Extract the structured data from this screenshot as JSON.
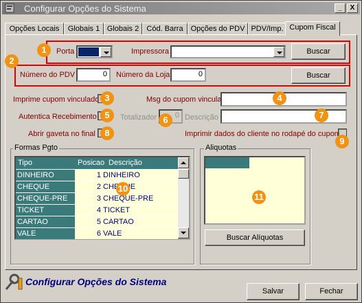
{
  "window": {
    "title": "Configurar Opções do Sistema",
    "minimize": "_",
    "close": "X"
  },
  "tabs": [
    {
      "label": "Opções Locais"
    },
    {
      "label": "Globais 1"
    },
    {
      "label": "Globais 2"
    },
    {
      "label": "Cód. Barra"
    },
    {
      "label": "Opções do PDV"
    },
    {
      "label": "PDV/Imp."
    },
    {
      "label": "Cupom Fiscal"
    }
  ],
  "printer": {
    "port_label": "Porta",
    "port_value": "",
    "printer_label": "Impressora",
    "printer_value": "",
    "search_label": "Buscar"
  },
  "pdv": {
    "pdv_number_label": "Número do PDV",
    "pdv_number_value": "0",
    "store_number_label": "Número da Loja",
    "store_number_value": "0",
    "search_label": "Buscar"
  },
  "options": {
    "print_linked_coupon": "Imprime cupom vinculado",
    "linked_coupon_msg_label": "Msg do cupom vinculado",
    "linked_coupon_msg_value": "",
    "authenticate_receipt": "Autentica Recebimento",
    "totalizer_label": "Totalizador",
    "totalizer_value": "0",
    "description_label": "Descrição",
    "description_value": "",
    "open_drawer": "Abrir gaveta no final",
    "print_client_data": "Imprimir dados do cliente no rodapé do cupom"
  },
  "payment_forms": {
    "title": "Formas Pgto",
    "columns": [
      "Tipo",
      "Posicao",
      "Descrição"
    ],
    "rows": [
      {
        "tipo": "DINHEIRO",
        "posicao": "1",
        "descricao": "DINHEIRO"
      },
      {
        "tipo": "CHEQUE",
        "posicao": "2",
        "descricao": "CHEQUE"
      },
      {
        "tipo": "CHEQUE-PRE",
        "posicao": "3",
        "descricao": "CHEQUE-PRE"
      },
      {
        "tipo": "TICKET",
        "posicao": "4",
        "descricao": "TICKET"
      },
      {
        "tipo": "CARTAO",
        "posicao": "5",
        "descricao": "CARTAO"
      },
      {
        "tipo": "VALE",
        "posicao": "6",
        "descricao": "VALE"
      }
    ]
  },
  "aliquotas": {
    "title": "Aliquotas",
    "search_label": "Buscar Alíquotas"
  },
  "badges": [
    "1",
    "2",
    "3",
    "4",
    "5",
    "6",
    "7",
    "8",
    "9",
    "10",
    "11"
  ],
  "footer": {
    "title": "Configurar Opções do Sistema",
    "save_label": "Salvar",
    "close_label": "Fechar"
  },
  "colors": {
    "highlight": "#e00000",
    "badge": "#f29213",
    "grid_header": "#3a7a7a",
    "grid_cell": "#ffffd8",
    "title_text": "#000080"
  }
}
